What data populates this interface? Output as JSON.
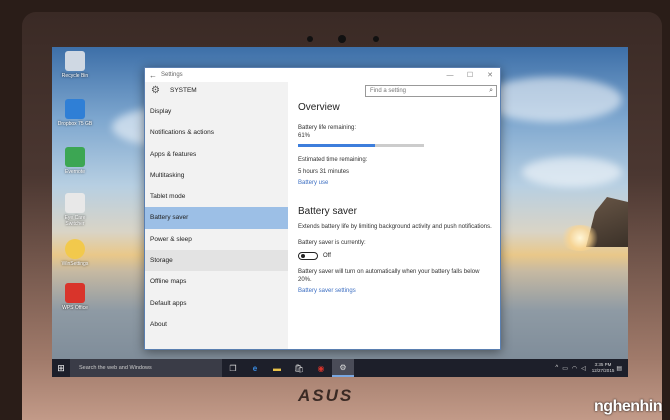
{
  "desktop_icons": [
    {
      "label": "Recycle Bin",
      "icon": "recycle-bin-icon",
      "color": "#cfd8e3"
    },
    {
      "label": "Dropbox 75 GB",
      "icon": "dropbox-icon",
      "color": "#2f7fd6"
    },
    {
      "label": "Evernote",
      "icon": "evernote-icon",
      "color": "#3ca653"
    },
    {
      "label": "Eye Care Switcher",
      "icon": "eye-care-icon",
      "color": "#e8e8e8"
    },
    {
      "label": "WinSettings",
      "icon": "sun-settings-icon",
      "color": "#f2c94c"
    },
    {
      "label": "WPS Office",
      "icon": "wps-office-icon",
      "color": "#d9342b"
    }
  ],
  "window": {
    "title": "Settings",
    "section": "SYSTEM",
    "search_placeholder": "Find a setting"
  },
  "nav": [
    {
      "label": "Display"
    },
    {
      "label": "Notifications & actions"
    },
    {
      "label": "Apps & features"
    },
    {
      "label": "Multitasking"
    },
    {
      "label": "Tablet mode"
    },
    {
      "label": "Battery saver",
      "selected": true
    },
    {
      "label": "Power & sleep"
    },
    {
      "label": "Storage",
      "hovered": true
    },
    {
      "label": "Offline maps"
    },
    {
      "label": "Default apps"
    },
    {
      "label": "About"
    }
  ],
  "overview": {
    "heading": "Overview",
    "battery_label": "Battery life remaining:",
    "battery_value": "61%",
    "battery_fraction": 0.61,
    "time_label": "Estimated time remaining:",
    "time_value": "5 hours 31 minutes",
    "battery_use_link": "Battery use"
  },
  "battery_saver": {
    "heading": "Battery saver",
    "description": "Extends battery life by limiting background activity and push notifications.",
    "status_label": "Battery saver is currently:",
    "toggle_state": "Off",
    "auto_note": "Battery saver will turn on automatically when your battery falls below 20%.",
    "settings_link": "Battery saver settings"
  },
  "taskbar": {
    "search_placeholder": "Search the web and Windows",
    "time": "3:35 PM",
    "date": "12/27/2015"
  },
  "brand": {
    "logo": "ASUS",
    "watermark": "nghenhin"
  },
  "colors": {
    "accent": "#3d7edc",
    "selected_nav": "#9cbfe6",
    "link": "#3d6fc2"
  }
}
